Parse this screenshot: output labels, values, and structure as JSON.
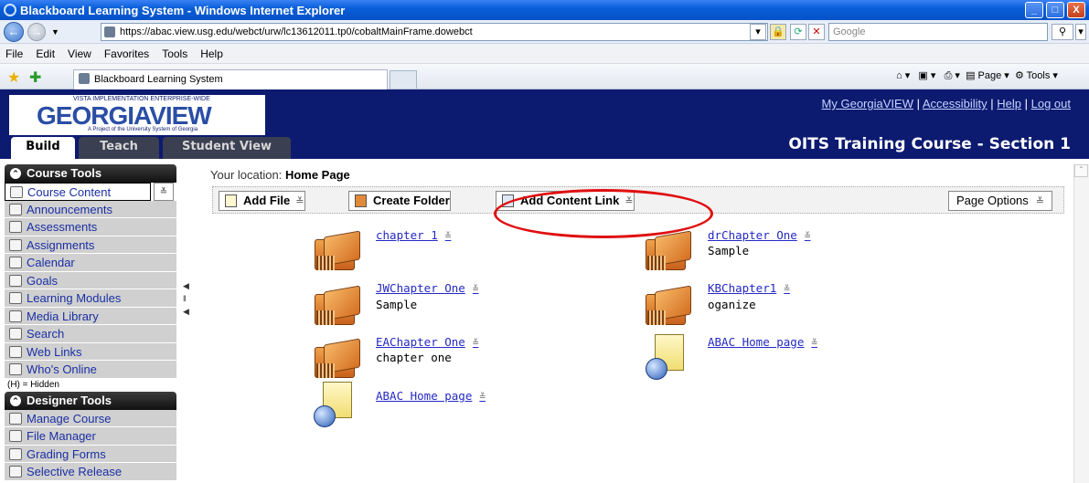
{
  "window": {
    "title": "Blackboard Learning System - Windows Internet Explorer",
    "min": "_",
    "max": "□",
    "close": "X"
  },
  "address": {
    "back": "←",
    "forward": "→",
    "url": "https://abac.view.usg.edu/webct/urw/lc13612011.tp0/cobaltMainFrame.dowebct",
    "search_placeholder": "Google"
  },
  "menu": [
    "File",
    "Edit",
    "View",
    "Favorites",
    "Tools",
    "Help"
  ],
  "tab": {
    "label": "Blackboard Learning System"
  },
  "commands": {
    "page": "Page",
    "tools": "Tools"
  },
  "header": {
    "logo_top": "VISTA IMPLEMENTATION ENTERPRISE-WIDE",
    "logo_main": "GEORGIAVIEW",
    "logo_sub": "A Project of the University System of Georgia",
    "links": [
      "My GeorgiaVIEW",
      "Accessibility",
      "Help",
      "Log out"
    ],
    "course_title": "OITS Training Course - Section 1",
    "tabs": [
      "Build",
      "Teach",
      "Student View"
    ]
  },
  "sidebar": {
    "course_tools_title": "Course Tools",
    "course_tools": [
      "Course Content",
      "Announcements",
      "Assessments",
      "Assignments",
      "Calendar",
      "Goals",
      "Learning Modules",
      "Media Library",
      "Search",
      "Web Links",
      "Who's Online"
    ],
    "hidden_note": "(H) = Hidden",
    "designer_tools_title": "Designer Tools",
    "designer_tools": [
      "Manage Course",
      "File Manager",
      "Grading Forms",
      "Selective Release"
    ]
  },
  "content": {
    "location_label": "Your location:",
    "location_value": "Home Page",
    "actions": {
      "add_file": "Add File",
      "create_folder": "Create Folder",
      "add_content_link": "Add Content Link",
      "page_options": "Page Options"
    },
    "items": [
      {
        "title": "chapter 1",
        "desc": ""
      },
      {
        "title": "drChapter One",
        "desc": "Sample"
      },
      {
        "title": "JWChapter One",
        "desc": "Sample"
      },
      {
        "title": "KBChapter1",
        "desc": "oganize"
      },
      {
        "title": "EAChapter One",
        "desc": "chapter one"
      },
      {
        "title": "ABAC Home page",
        "desc": ""
      },
      {
        "title": "ABAC Home page",
        "desc": ""
      }
    ]
  },
  "colors": {
    "header_bg": "#0c1a70",
    "highlight_oval": "#e01010",
    "link": "#2428c4"
  }
}
